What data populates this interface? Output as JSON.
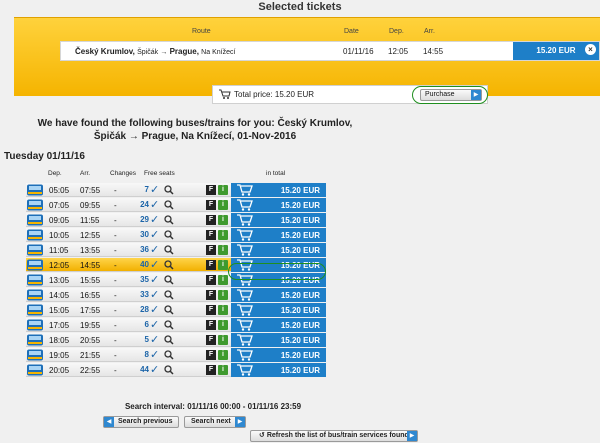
{
  "page_title": "Selected tickets",
  "selected": {
    "headers": {
      "route": "Route",
      "date": "Date",
      "dep": "Dep.",
      "arr": "Arr."
    },
    "route_from": "Český Krumlov,",
    "route_from_sub": "Špičák",
    "route_arrow": "→",
    "route_to": "Prague,",
    "route_to_sub": "Na Knížecí",
    "date": "01/11/16",
    "dep": "12:05",
    "arr": "14:55",
    "price": "15.20 EUR",
    "remove_label": "×",
    "total_label": "Total price: 15.20 EUR",
    "purchase_label": "Purchase"
  },
  "found_text": "We have found the following buses/trains for you: Český Krumlov, Špičák → Prague, Na Knížecí, 01-Nov-2016",
  "day_heading": "Tuesday 01/11/16",
  "table": {
    "headers": {
      "dep": "Dep.",
      "arr": "Arr.",
      "changes": "Changes",
      "free_seats": "Free seats",
      "total": "in total"
    },
    "rows": [
      {
        "dep": "05:05",
        "arr": "07:55",
        "changes": "-",
        "seats": "7",
        "price": "15.20 EUR",
        "highlight": false
      },
      {
        "dep": "07:05",
        "arr": "09:55",
        "changes": "-",
        "seats": "24",
        "price": "15.20 EUR",
        "highlight": false
      },
      {
        "dep": "09:05",
        "arr": "11:55",
        "changes": "-",
        "seats": "29",
        "price": "15.20 EUR",
        "highlight": false
      },
      {
        "dep": "10:05",
        "arr": "12:55",
        "changes": "-",
        "seats": "30",
        "price": "15.20 EUR",
        "highlight": false
      },
      {
        "dep": "11:05",
        "arr": "13:55",
        "changes": "-",
        "seats": "36",
        "price": "15.20 EUR",
        "highlight": false
      },
      {
        "dep": "12:05",
        "arr": "14:55",
        "changes": "-",
        "seats": "40",
        "price": "15.20 EUR",
        "highlight": true
      },
      {
        "dep": "13:05",
        "arr": "15:55",
        "changes": "-",
        "seats": "35",
        "price": "15.20 EUR",
        "highlight": false
      },
      {
        "dep": "14:05",
        "arr": "16:55",
        "changes": "-",
        "seats": "33",
        "price": "15.20 EUR",
        "highlight": false
      },
      {
        "dep": "15:05",
        "arr": "17:55",
        "changes": "-",
        "seats": "28",
        "price": "15.20 EUR",
        "highlight": false
      },
      {
        "dep": "17:05",
        "arr": "19:55",
        "changes": "-",
        "seats": "6",
        "price": "15.20 EUR",
        "highlight": false
      },
      {
        "dep": "18:05",
        "arr": "20:55",
        "changes": "-",
        "seats": "5",
        "price": "15.20 EUR",
        "highlight": false
      },
      {
        "dep": "19:05",
        "arr": "21:55",
        "changes": "-",
        "seats": "8",
        "price": "15.20 EUR",
        "highlight": false
      },
      {
        "dep": "20:05",
        "arr": "22:55",
        "changes": "-",
        "seats": "44",
        "price": "15.20 EUR",
        "highlight": false
      }
    ]
  },
  "search_interval": "Search interval: 01/11/16 00:00 - 01/11/16 23:59",
  "buttons": {
    "search_previous": "Search previous",
    "search_next": "Search next",
    "refresh": "Refresh the list of bus/train services found"
  },
  "colors": {
    "accent_blue": "#1e7fc8",
    "yellow": "#f5b400",
    "highlight_green": "#1f8f1f"
  }
}
